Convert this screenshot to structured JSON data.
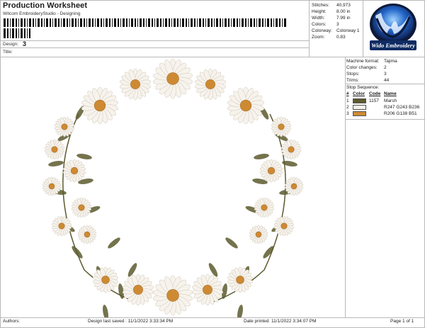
{
  "header": {
    "title": "Production Worksheet",
    "subtitle": "Wilcom EmbroideryStudio - Designing",
    "design_label": "Design:",
    "design_value": "3",
    "title_label": "Title:"
  },
  "stats": [
    {
      "label": "Stitches:",
      "value": "40,973"
    },
    {
      "label": "Height:",
      "value": "8.00 in"
    },
    {
      "label": "Width:",
      "value": "7.99 in"
    },
    {
      "label": "Colors:",
      "value": "3"
    },
    {
      "label": "Colorway:",
      "value": "Colorway 1"
    },
    {
      "label": "Zoom:",
      "value": "0.83"
    }
  ],
  "logo": {
    "text": "Wido Embroidery"
  },
  "machine": [
    {
      "label": "Machine format:",
      "value": "Tajima"
    },
    {
      "label": "Color changes:",
      "value": "2"
    },
    {
      "label": "Stops:",
      "value": "3"
    },
    {
      "label": "Trims:",
      "value": "44"
    }
  ],
  "stop_sequence": {
    "title": "Stop Sequence:",
    "columns": [
      "#",
      "Color",
      "Code",
      "Name"
    ],
    "rows": [
      {
        "num": "1",
        "color": "#5c5a2e",
        "code": "1157",
        "name": "Marsh"
      },
      {
        "num": "2",
        "color": "#f7f3ec",
        "code": "",
        "name": "R247 G243 B236"
      },
      {
        "num": "3",
        "color": "#ce8a33",
        "code": "",
        "name": "R206 G138 B51"
      }
    ]
  },
  "footer": {
    "authors": "Authors:",
    "last_saved": "Design last saved : 11/1/2022 3:33:34 PM",
    "printed": "Date printed: 11/1/2022 3:34:07 PM",
    "page": "Page 1 of 1"
  }
}
